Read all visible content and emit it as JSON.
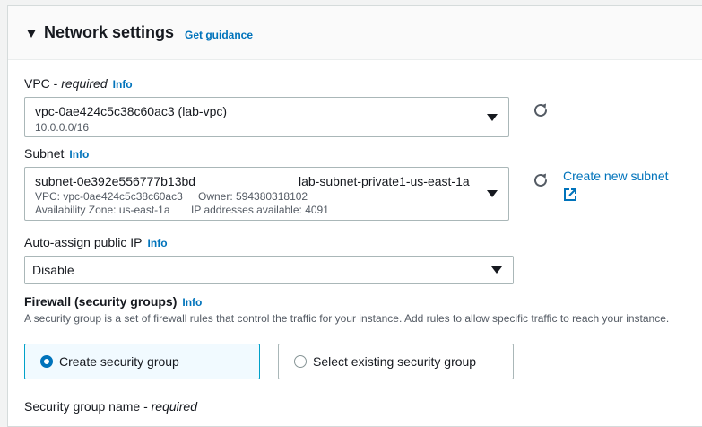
{
  "section": {
    "title": "Network settings",
    "guidance_link": "Get guidance"
  },
  "vpc": {
    "label": "VPC - ",
    "required": "required",
    "info": "Info",
    "value": "vpc-0ae424c5c38c60ac3 (lab-vpc)",
    "cidr": "10.0.0.0/16"
  },
  "subnet": {
    "label": "Subnet",
    "info": "Info",
    "id": "subnet-0e392e556777b13bd",
    "name": "lab-subnet-private1-us-east-1a",
    "vpc_line": "VPC: vpc-0ae424c5c38c60ac3",
    "owner_line": "Owner: 594380318102",
    "az_line": "Availability Zone: us-east-1a",
    "ip_line": "IP addresses available: 4091",
    "create_link": "Create new subnet"
  },
  "public_ip": {
    "label": "Auto-assign public IP",
    "info": "Info",
    "value": "Disable"
  },
  "firewall": {
    "label": "Firewall (security groups)",
    "info": "Info",
    "description": "A security group is a set of firewall rules that control the traffic for your instance. Add rules to allow specific traffic to reach your instance.",
    "option_create": "Create security group",
    "option_select": "Select existing security group",
    "selected": "create"
  },
  "sg_name": {
    "label": "Security group name - ",
    "required": "required"
  },
  "icons": {
    "caret": "caret-down-icon",
    "refresh": "refresh-icon",
    "external": "external-link-icon",
    "dropdown": "dropdown-caret-icon"
  },
  "colors": {
    "link": "#0073bb",
    "selected_border": "#00a1c9",
    "selected_bg": "#f1faff"
  }
}
